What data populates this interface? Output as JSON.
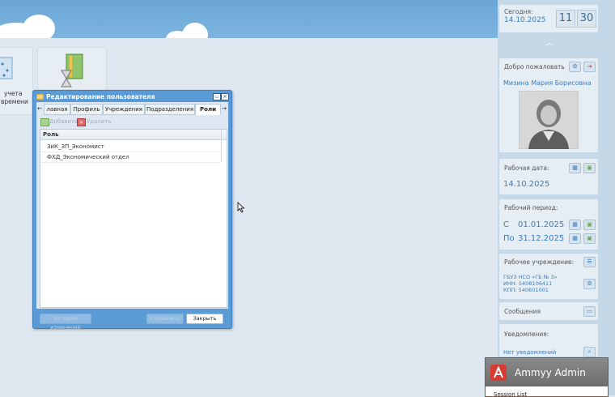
{
  "top": {
    "date_label": "Сегодня:",
    "date_value": "14.10.2025",
    "clock_hours": "11",
    "clock_minutes": "30"
  },
  "tiles": [
    {
      "label_line1": "учета",
      "label_line2": "времени"
    }
  ],
  "dialog": {
    "title": "Редактирование пользователя",
    "tabs": [
      {
        "label": "лавная"
      },
      {
        "label": "Профиль"
      },
      {
        "label": "Учреждения"
      },
      {
        "label": "Подразделения"
      },
      {
        "label": "Роли"
      }
    ],
    "toolbar": {
      "add_label": "Добавить",
      "delete_label": "Удалить"
    },
    "grid": {
      "column": "Роль",
      "rows": [
        "ЗиК_ЗП_Экономист",
        "ФХД_Экономический отдел"
      ]
    },
    "footer": {
      "history_label": "История изменений",
      "save_label": "Сохранить",
      "close_label": "Закрыть"
    }
  },
  "panel": {
    "welcome_label": "Добро пожаловать",
    "user_name": "Мизина Мария Борисовна",
    "workdate_label": "Рабочая дата:",
    "workdate_value": "14.10.2025",
    "period_label": "Рабочий период:",
    "period_from_prefix": "С",
    "period_from": "01.01.2025",
    "period_to_prefix": "По",
    "period_to": "31.12.2025",
    "institution_label": "Рабочее учреждение:",
    "institution_line1": "ГБУЗ НСО «ГБ № 3»",
    "institution_line2": "ИНН: 5408106411",
    "institution_line3": "КПП: 540801001",
    "messages_label": "Сообщения",
    "notifications_label": "Уведомления:",
    "notifications_value": "Нет уведомлений"
  },
  "ammyy": {
    "title": "Ammyy Admin",
    "sub": "Session List"
  },
  "colors": {
    "accent": "#3d7cb8",
    "dialog_frame": "#5b9bd5",
    "ammyy_border": "#c0392b"
  }
}
